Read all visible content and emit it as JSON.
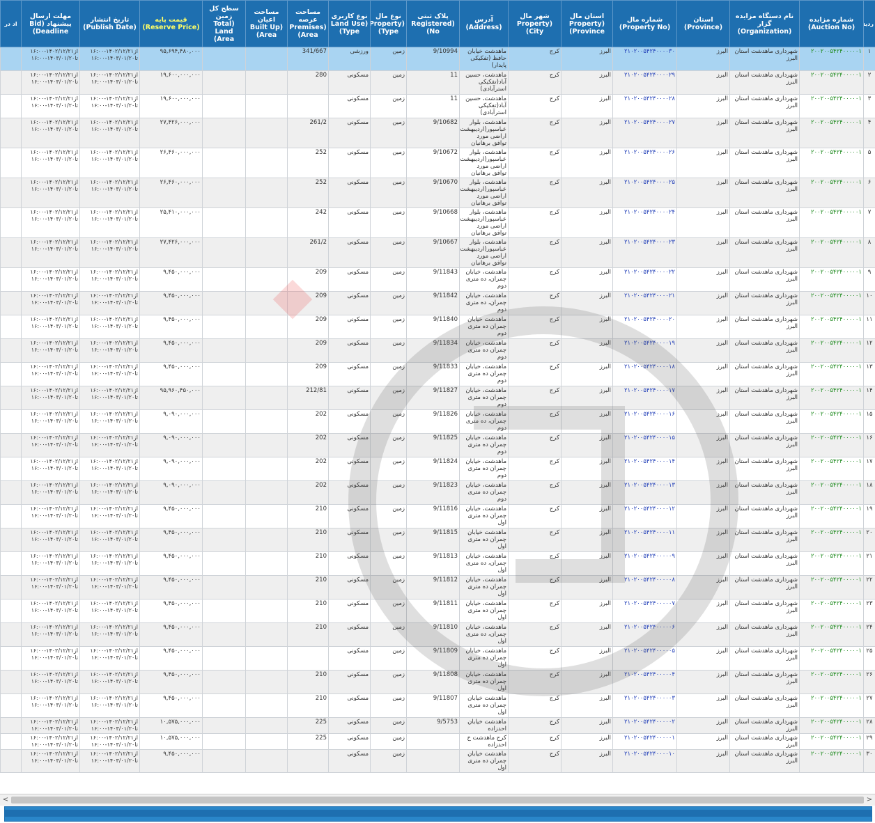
{
  "headers": {
    "row": "ردیف",
    "auction_no": "شماره مزایده (Auction No)",
    "organization": "نام دستگاه مزایده گزار (Organization)",
    "province": "استان (Province)",
    "property_no": "شماره مال (Property No)",
    "property_province": "استان مال (Property Province)",
    "property_city": "شهر مال (Property City)",
    "address": "آدرس (Address)",
    "registered_no": "پلاک ثبتی (Registered No)",
    "property_type": "نوع مال (Property Type)",
    "land_use": "نوع کاربری (Land Use Type)",
    "premises_area": "مساحت عرصه (Premises Area)",
    "built_up_area": "مساحت اعیان (Built Up Area)",
    "total_land_area": "سطح کل زمین (Total Land Area)",
    "reserve_price": "قیمت پایه (Reserve Price)",
    "publish_date": "تاریخ انتشار (Publish Date)",
    "deadline": "مهلت ارسال پیشنهاد (Bid Deadline)",
    "extra": "اد در"
  },
  "common": {
    "organization": "شهرداری ماهدشت استان البرز",
    "province": "البرز",
    "property_province": "البرز",
    "property_city": "کرج",
    "property_type": "زمین",
    "publish_date": "از۱۴۰۲/۱۲/۲۱-۱۶:۰۰ تا۱۴۰۳/۰۱/۲۰-۱۶:۰۰",
    "deadline": "از۱۴۰۲/۱۲/۲۱-۱۶:۰۰ تا۱۴۰۳/۰۱/۲۰-۱۶:۰۰"
  },
  "rows": [
    {
      "n": "۱",
      "auction": "۲۰۰۲۰۰۵۴۲۴۰۰۰۰۰۱",
      "prop": "۲۱۰۲۰۰۵۴۲۴۰۰۰۰۳۰",
      "addr": "ماهدشت خیابان حافظ (تفکیکی پایدار)",
      "reg": "9/10994",
      "use": "ورزشی",
      "area": "341/667",
      "price": "۹۵,۶۹۴,۴۸۰,۰۰۰"
    },
    {
      "n": "۲",
      "auction": "۲۰۰۲۰۰۵۴۲۴۰۰۰۰۰۱",
      "prop": "۲۱۰۲۰۰۵۴۲۴۰۰۰۰۲۹",
      "addr": "ماهدشت، حسین آباد(تفکیکی استرآبادی)",
      "reg": "11",
      "use": "مسکونی",
      "area": "280",
      "price": "۱۹,۶۰۰,۰۰۰,۰۰۰"
    },
    {
      "n": "۳",
      "auction": "۲۰۰۲۰۰۵۴۲۴۰۰۰۰۰۱",
      "prop": "۲۱۰۲۰۰۵۴۲۴۰۰۰۰۲۸",
      "addr": "ماهدشت، حسین آباد(تفکیکی استرآبادی)",
      "reg": "11",
      "use": "مسکونی",
      "area": "",
      "price": "۱۹,۶۰۰,۰۰۰,۰۰۰"
    },
    {
      "n": "۴",
      "auction": "۲۰۰۲۰۰۵۴۲۴۰۰۰۰۰۱",
      "prop": "۲۱۰۲۰۰۵۴۲۴۰۰۰۰۲۷",
      "addr": "ماهدشت، بلوار عباسپور(اردیبهشت اراضی مورد توافق برهانیان",
      "reg": "9/10682",
      "use": "مسکونی",
      "area": "261/2",
      "price": "۲۷,۴۲۶,۰۰۰,۰۰۰"
    },
    {
      "n": "۵",
      "auction": "۲۰۰۲۰۰۵۴۲۴۰۰۰۰۰۱",
      "prop": "۲۱۰۲۰۰۵۴۲۴۰۰۰۰۲۶",
      "addr": "ماهدشت، بلوار عباسپور(اردیبهشت اراضی مورد توافق برهانیان",
      "reg": "9/10672",
      "use": "مسکونی",
      "area": "252",
      "price": "۲۶,۴۶۰,۰۰۰,۰۰۰"
    },
    {
      "n": "۶",
      "auction": "۲۰۰۲۰۰۵۴۲۴۰۰۰۰۰۱",
      "prop": "۲۱۰۲۰۰۵۴۲۴۰۰۰۰۲۵",
      "addr": "ماهدشت، بلوار عباسپور(اردیبهشت اراضی مورد توافق برهانیان",
      "reg": "9/10670",
      "use": "مسکونی",
      "area": "252",
      "price": "۲۶,۴۶۰,۰۰۰,۰۰۰"
    },
    {
      "n": "۷",
      "auction": "۲۰۰۲۰۰۵۴۲۴۰۰۰۰۰۱",
      "prop": "۲۱۰۲۰۰۵۴۲۴۰۰۰۰۲۴",
      "addr": "ماهدشت، بلوار عباسپور(اردیبهشت اراضی مورد توافق برهانیان",
      "reg": "9/10668",
      "use": "مسکونی",
      "area": "242",
      "price": "۲۵,۴۱۰,۰۰۰,۰۰۰"
    },
    {
      "n": "۸",
      "auction": "۲۰۰۲۰۰۵۴۲۴۰۰۰۰۰۱",
      "prop": "۲۱۰۲۰۰۵۴۲۴۰۰۰۰۲۳",
      "addr": "ماهدشت، بلوار عباسپور(اردیبهشت اراضی مورد توافق برهانیان",
      "reg": "9/10667",
      "use": "مسکونی",
      "area": "261/2",
      "price": "۲۷,۴۲۶,۰۰۰,۰۰۰"
    },
    {
      "n": "۹",
      "auction": "۲۰۰۲۰۰۵۴۲۴۰۰۰۰۰۱",
      "prop": "۲۱۰۲۰۰۵۴۲۴۰۰۰۰۲۲",
      "addr": "ماهدشت، خیابان چمران، ده متری دوم",
      "reg": "9/11843",
      "use": "مسکونی",
      "area": "209",
      "price": "۹,۴۵۰,۰۰۰,۰۰۰"
    },
    {
      "n": "۱۰",
      "auction": "۲۰۰۲۰۰۵۴۲۴۰۰۰۰۰۱",
      "prop": "۲۱۰۲۰۰۵۴۲۴۰۰۰۰۲۱",
      "addr": "ماهدشت، خیابان چمران، ده متری دوم",
      "reg": "9/11842",
      "use": "مسکونی",
      "area": "209",
      "price": "۹,۴۵۰,۰۰۰,۰۰۰"
    },
    {
      "n": "۱۱",
      "auction": "۲۰۰۲۰۰۵۴۲۴۰۰۰۰۰۱",
      "prop": "۲۱۰۲۰۰۵۴۲۴۰۰۰۰۲۰",
      "addr": "ماهدشت خیابان چمران ده متری دوم",
      "reg": "9/11840",
      "use": "مسکونی",
      "area": "209",
      "price": "۹,۴۵۰,۰۰۰,۰۰۰"
    },
    {
      "n": "۱۲",
      "auction": "۲۰۰۲۰۰۵۴۲۴۰۰۰۰۰۱",
      "prop": "۲۱۰۲۰۰۵۴۲۴۰۰۰۰۱۹",
      "addr": "ماهدشت، خیابان چمران ده متری دوم",
      "reg": "9/11834",
      "use": "مسکونی",
      "area": "209",
      "price": "۹,۴۵۰,۰۰۰,۰۰۰"
    },
    {
      "n": "۱۳",
      "auction": "۲۰۰۲۰۰۵۴۲۴۰۰۰۰۰۱",
      "prop": "۲۱۰۲۰۰۵۴۲۴۰۰۰۰۱۸",
      "addr": "ماهدشت، خیابان چمران ده متری دوم",
      "reg": "9/11833",
      "use": "مسکونی",
      "area": "209",
      "price": "۹,۴۵۰,۰۰۰,۰۰۰"
    },
    {
      "n": "۱۴",
      "auction": "۲۰۰۲۰۰۵۴۲۴۰۰۰۰۰۱",
      "prop": "۲۱۰۲۰۰۵۴۲۴۰۰۰۰۱۷",
      "addr": "ماهدشت، خیابان چمران ده متری دوم",
      "reg": "9/11827",
      "use": "مسکونی",
      "area": "212/81",
      "price": "۹۵,۹۶۰,۴۵۰,۰۰۰"
    },
    {
      "n": "۱۵",
      "auction": "۲۰۰۲۰۰۵۴۲۴۰۰۰۰۰۱",
      "prop": "۲۱۰۲۰۰۵۴۲۴۰۰۰۰۱۶",
      "addr": "ماهدشت، خیابان چمران، ده متری دوم",
      "reg": "9/11826",
      "use": "مسکونی",
      "area": "202",
      "price": "۹,۰۹۰,۰۰۰,۰۰۰"
    },
    {
      "n": "۱۶",
      "auction": "۲۰۰۲۰۰۵۴۲۴۰۰۰۰۰۱",
      "prop": "۲۱۰۲۰۰۵۴۲۴۰۰۰۰۱۵",
      "addr": "ماهدشت، خیابان چمران ده متری دوم",
      "reg": "9/11825",
      "use": "مسکونی",
      "area": "202",
      "price": "۹,۰۹۰,۰۰۰,۰۰۰"
    },
    {
      "n": "۱۷",
      "auction": "۲۰۰۲۰۰۵۴۲۴۰۰۰۰۰۱",
      "prop": "۲۱۰۲۰۰۵۴۲۴۰۰۰۰۱۴",
      "addr": "ماهدشت، خیابان چمران ده متری دوم",
      "reg": "9/11824",
      "use": "مسکونی",
      "area": "202",
      "price": "۹,۰۹۰,۰۰۰,۰۰۰"
    },
    {
      "n": "۱۸",
      "auction": "۲۰۰۲۰۰۵۴۲۴۰۰۰۰۰۱",
      "prop": "۲۱۰۲۰۰۵۴۲۴۰۰۰۰۱۳",
      "addr": "ماهدشت، خیابان چمران ده متری دوم",
      "reg": "9/11823",
      "use": "مسکونی",
      "area": "202",
      "price": "۹,۰۹۰,۰۰۰,۰۰۰"
    },
    {
      "n": "۱۹",
      "auction": "۲۰۰۲۰۰۵۴۲۴۰۰۰۰۰۱",
      "prop": "۲۱۰۲۰۰۵۴۲۴۰۰۰۰۱۲",
      "addr": "ماهدشت، خیابان چمران ده متری اول",
      "reg": "9/11816",
      "use": "مسکونی",
      "area": "210",
      "price": "۹,۴۵۰,۰۰۰,۰۰۰"
    },
    {
      "n": "۲۰",
      "auction": "۲۰۰۲۰۰۵۴۲۴۰۰۰۰۰۱",
      "prop": "۲۱۰۲۰۰۵۴۲۴۰۰۰۰۱۱",
      "addr": "ماهدشت خیابان چمران ده متری اول",
      "reg": "9/11815",
      "use": "مسکونی",
      "area": "210",
      "price": "۹,۴۵۰,۰۰۰,۰۰۰"
    },
    {
      "n": "۲۱",
      "auction": "۲۰۰۲۰۰۵۴۲۴۰۰۰۰۰۱",
      "prop": "۲۱۰۲۰۰۵۴۲۴۰۰۰۰۰۹",
      "addr": "ماهدشت، خیابان چمران، ده متری اول",
      "reg": "9/11813",
      "use": "مسکونی",
      "area": "210",
      "price": "۹,۴۵۰,۰۰۰,۰۰۰"
    },
    {
      "n": "۲۲",
      "auction": "۲۰۰۲۰۰۵۴۲۴۰۰۰۰۰۱",
      "prop": "۲۱۰۲۰۰۵۴۲۴۰۰۰۰۰۸",
      "addr": "ماهدشت، خیابان چمران ده متری اول",
      "reg": "9/11812",
      "use": "مسکونی",
      "area": "210",
      "price": "۹,۴۵۰,۰۰۰,۰۰۰"
    },
    {
      "n": "۲۳",
      "auction": "۲۰۰۲۰۰۵۴۲۴۰۰۰۰۰۱",
      "prop": "۲۱۰۲۰۰۵۴۲۴۰۰۰۰۰۷",
      "addr": "ماهدشت، خیابان چمران ده متری اول",
      "reg": "9/11811",
      "use": "مسکونی",
      "area": "210",
      "price": "۹,۴۵۰,۰۰۰,۰۰۰"
    },
    {
      "n": "۲۴",
      "auction": "۲۰۰۲۰۰۵۴۲۴۰۰۰۰۰۱",
      "prop": "۲۱۰۲۰۰۵۴۲۴۰۰۰۰۰۶",
      "addr": "ماهدشت، خیابان چمران، ده متری اول",
      "reg": "9/11810",
      "use": "مسکونی",
      "area": "210",
      "price": "۹,۴۵۰,۰۰۰,۰۰۰"
    },
    {
      "n": "۲۵",
      "auction": "۲۰۰۲۰۰۵۴۲۴۰۰۰۰۰۱",
      "prop": "۲۱۰۲۰۰۵۴۲۴۰۰۰۰۰۵",
      "addr": "ماهدشت، خیابان چمران ده متری اول",
      "reg": "9/11809",
      "use": "مسکونی",
      "area": "",
      "price": "۹,۴۵۰,۰۰۰,۰۰۰"
    },
    {
      "n": "۲۶",
      "auction": "۲۰۰۲۰۰۵۴۲۴۰۰۰۰۰۱",
      "prop": "۲۱۰۲۰۰۵۴۲۴۰۰۰۰۰۴",
      "addr": "ماهدشت، خیابان چمران ده متری اول",
      "reg": "9/11808",
      "use": "مسکونی",
      "area": "210",
      "price": "۹,۴۵۰,۰۰۰,۰۰۰"
    },
    {
      "n": "۲۷",
      "auction": "۲۰۰۲۰۰۵۴۲۴۰۰۰۰۰۱",
      "prop": "۲۱۰۲۰۰۵۴۲۴۰۰۰۰۰۳",
      "addr": "ماهدشت خیابان چمران ده متری اول",
      "reg": "9/11807",
      "use": "مسکونی",
      "area": "210",
      "price": "۹,۴۵۰,۰۰۰,۰۰۰"
    },
    {
      "n": "۲۸",
      "auction": "۲۰۰۲۰۰۵۴۲۴۰۰۰۰۰۱",
      "prop": "۲۱۰۲۰۰۵۴۲۴۰۰۰۰۰۲",
      "addr": "ماهدشت خیابان احدزاده",
      "reg": "9/5753",
      "use": "مسکونی",
      "area": "225",
      "price": "۱۰,۵۷۵,۰۰۰,۰۰۰"
    },
    {
      "n": "۲۹",
      "auction": "۲۰۰۲۰۰۵۴۲۴۰۰۰۰۰۱",
      "prop": "۲۱۰۲۰۰۵۴۲۴۰۰۰۰۰۱",
      "addr": "کرج ماهدشت خ احدزاده",
      "reg": "",
      "use": "مسکونی",
      "area": "225",
      "price": "۱۰,۵۷۵,۰۰۰,۰۰۰"
    },
    {
      "n": "۳۰",
      "auction": "۲۰۰۲۰۰۵۴۲۴۰۰۰۰۰۱",
      "prop": "۲۱۰۲۰۰۵۴۲۴۰۰۰۰۱۰",
      "addr": "ماهدشت خیابان چمران ده متری اول",
      "reg": "",
      "use": "مسکونی",
      "area": "",
      "price": "۹,۴۵۰,۰۰۰,۰۰۰"
    }
  ],
  "scroll": {
    "left_arrow": "<",
    "right_arrow": ">"
  },
  "colors": {
    "header_bg": "#1e6fb0",
    "reserve_header": "#ffff66",
    "auction_text": "#1e8a1e",
    "property_text": "#2340b8",
    "selected_row": "#a9d4f2"
  }
}
